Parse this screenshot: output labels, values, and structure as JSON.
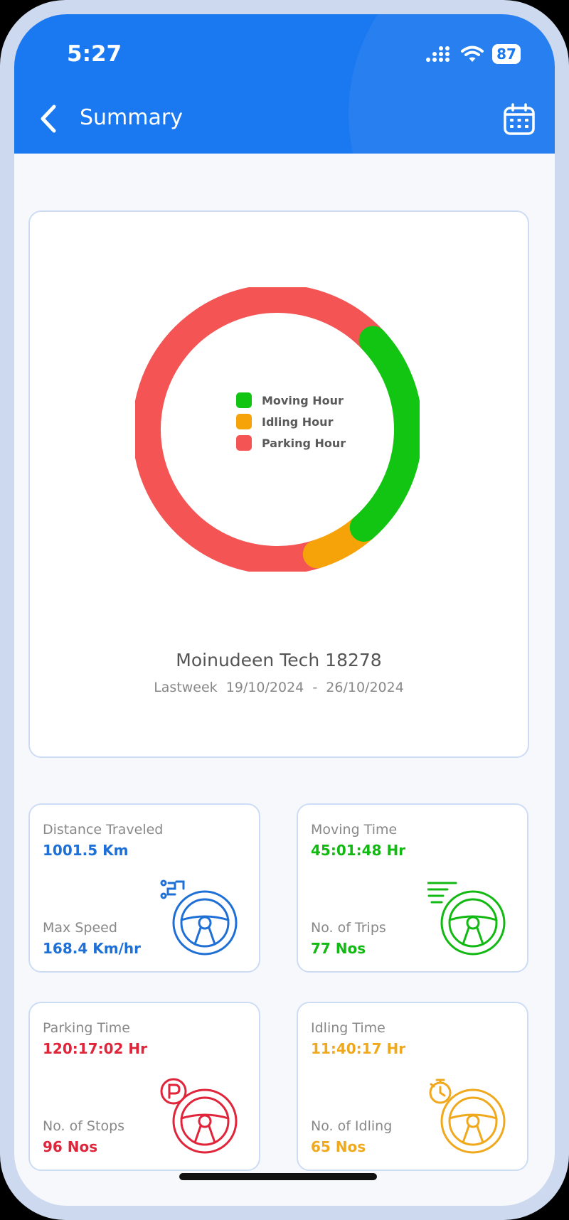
{
  "status_bar": {
    "time": "5:27",
    "battery": "87"
  },
  "header": {
    "title": "Summary",
    "back_icon": "chevron-left-icon",
    "calendar_icon": "calendar-icon"
  },
  "chart": {
    "vehicle_name": "Moinudeen Tech 18278",
    "date_range": "Lastweek  19/10/2024  -  26/10/2024"
  },
  "chart_data": {
    "type": "pie",
    "style": "donut",
    "legend_position": "center",
    "labels": [
      "Moving Hour",
      "Idling Hour",
      "Parking Hour"
    ],
    "values": [
      45.03,
      11.67,
      120.28
    ],
    "colors": [
      "#12c512",
      "#f6a30a",
      "#f45454"
    ]
  },
  "stats": [
    {
      "label1": "Distance Traveled",
      "value1": "1001.5 Km",
      "label2": "Max Speed",
      "value2": "168.4 Km/hr",
      "color": "#1e6fd6",
      "icon": "steering-wheel-route-icon"
    },
    {
      "label1": "Moving Time",
      "value1": "45:01:48 Hr",
      "label2": "No. of Trips",
      "value2": "77 Nos",
      "color": "#13b913",
      "icon": "steering-wheel-speed-icon"
    },
    {
      "label1": "Parking Time",
      "value1": "120:17:02 Hr",
      "label2": "No. of Stops",
      "value2": "96 Nos",
      "color": "#e0243a",
      "icon": "steering-wheel-parking-icon"
    },
    {
      "label1": "Idling Time",
      "value1": "11:40:17 Hr",
      "label2": "No. of Idling",
      "value2": "65 Nos",
      "color": "#f0a81d",
      "icon": "steering-wheel-timer-icon"
    }
  ]
}
